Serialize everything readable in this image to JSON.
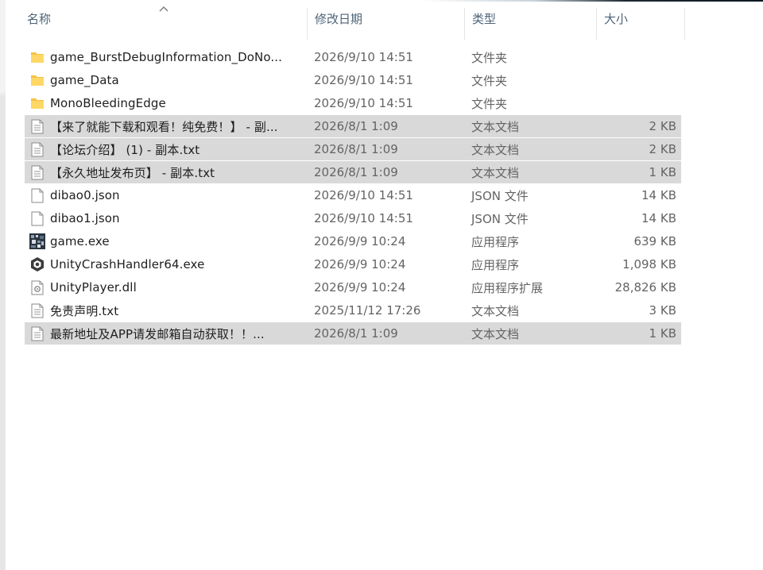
{
  "columns": {
    "name": "名称",
    "date": "修改日期",
    "type": "类型",
    "size": "大小"
  },
  "sort": {
    "column": "name",
    "direction": "ascending",
    "icon": "sort-up-chevron-icon"
  },
  "files": [
    {
      "icon": "folder-icon",
      "name": "game_BurstDebugInformation_DoNo...",
      "date": "2026/9/10 14:51",
      "type": "文件夹",
      "size": "",
      "selected": false
    },
    {
      "icon": "folder-icon",
      "name": "game_Data",
      "date": "2026/9/10 14:51",
      "type": "文件夹",
      "size": "",
      "selected": false
    },
    {
      "icon": "folder-icon",
      "name": "MonoBleedingEdge",
      "date": "2026/9/10 14:51",
      "type": "文件夹",
      "size": "",
      "selected": false
    },
    {
      "icon": "text-file-icon",
      "name": "【来了就能下载和观看！纯免费！】 - 副...",
      "date": "2026/8/1 1:09",
      "type": "文本文档",
      "size": "2 KB",
      "selected": true
    },
    {
      "icon": "text-file-icon",
      "name": "【论坛介绍】 (1) - 副本.txt",
      "date": "2026/8/1 1:09",
      "type": "文本文档",
      "size": "2 KB",
      "selected": true
    },
    {
      "icon": "text-file-icon",
      "name": "【永久地址发布页】 - 副本.txt",
      "date": "2026/8/1 1:09",
      "type": "文本文档",
      "size": "1 KB",
      "selected": true
    },
    {
      "icon": "blank-file-icon",
      "name": "dibao0.json",
      "date": "2026/9/10 14:51",
      "type": "JSON 文件",
      "size": "14 KB",
      "selected": false
    },
    {
      "icon": "blank-file-icon",
      "name": "dibao1.json",
      "date": "2026/9/10 14:51",
      "type": "JSON 文件",
      "size": "14 KB",
      "selected": false
    },
    {
      "icon": "game-exe-icon",
      "name": "game.exe",
      "date": "2026/9/9 10:24",
      "type": "应用程序",
      "size": "639 KB",
      "selected": false
    },
    {
      "icon": "unity-logo-icon",
      "name": "UnityCrashHandler64.exe",
      "date": "2026/9/9 10:24",
      "type": "应用程序",
      "size": "1,098 KB",
      "selected": false
    },
    {
      "icon": "dll-file-icon",
      "name": "UnityPlayer.dll",
      "date": "2026/9/9 10:24",
      "type": "应用程序扩展",
      "size": "28,826 KB",
      "selected": false
    },
    {
      "icon": "text-file-icon",
      "name": "免责声明.txt",
      "date": "2025/11/12 17:26",
      "type": "文本文档",
      "size": "3 KB",
      "selected": false
    },
    {
      "icon": "text-file-icon",
      "name": "最新地址及APP请发邮箱自动获取！！...",
      "date": "2026/8/1 1:09",
      "type": "文本文档",
      "size": "1 KB",
      "selected": true
    }
  ]
}
